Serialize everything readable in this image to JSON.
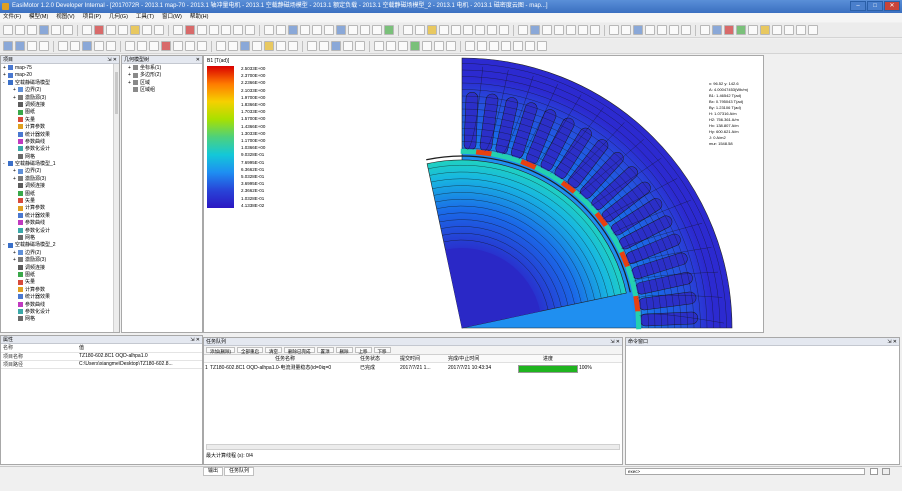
{
  "window": {
    "title": "EasiMotor 1.2.0 Developer Internal - [2017072R - 2013.1 map-70 - 2013.1 轴冲量电机 - 2013.1 空载静磁场模型 - 2013.1 额定负载 - 2013.1 空载静磁场模型_2 - 2013.1 电机 - 2013.1 磁密度云图 - map...]"
  },
  "menu": [
    "文件(F)",
    "模型(M)",
    "视图(V)",
    "项目(P)",
    "几何(G)",
    "工具(T)",
    "窗口(W)",
    "帮助(H)"
  ],
  "project_panel": {
    "title": "项目",
    "items": [
      {
        "label": "map-75",
        "depth": 0,
        "exp": "+",
        "icon": "#4a78d0"
      },
      {
        "label": "map-20",
        "depth": 0,
        "exp": "+",
        "icon": "#4a78d0"
      },
      {
        "label": "空载静磁场模型",
        "depth": 0,
        "exp": "-",
        "icon": "#3a6fc8"
      },
      {
        "label": "边界(2)",
        "depth": 1,
        "exp": "+",
        "icon": "#6090d8"
      },
      {
        "label": "激励源(3)",
        "depth": 1,
        "exp": "+",
        "icon": "#7a7a7a"
      },
      {
        "label": "调频连接",
        "depth": 1,
        "exp": "",
        "icon": "#5c5c5c"
      },
      {
        "label": "图纸",
        "depth": 1,
        "exp": "",
        "icon": "#3aa84a"
      },
      {
        "label": "矢量",
        "depth": 1,
        "exp": "",
        "icon": "#d84a3a"
      },
      {
        "label": "计算参数",
        "depth": 1,
        "exp": "",
        "icon": "#e0a020"
      },
      {
        "label": "统计器效果",
        "depth": 1,
        "exp": "",
        "icon": "#4a78d0"
      },
      {
        "label": "参数曲线",
        "depth": 1,
        "exp": "",
        "icon": "#c03ac0"
      },
      {
        "label": "参数化设计",
        "depth": 1,
        "exp": "",
        "icon": "#3aa8a8"
      },
      {
        "label": "网格",
        "depth": 1,
        "exp": "",
        "icon": "#6a6a6a"
      },
      {
        "label": "空载静磁场模型_1",
        "depth": 0,
        "exp": "-",
        "icon": "#3a6fc8"
      },
      {
        "label": "边界(2)",
        "depth": 1,
        "exp": "+",
        "icon": "#6090d8"
      },
      {
        "label": "激励源(3)",
        "depth": 1,
        "exp": "+",
        "icon": "#7a7a7a"
      },
      {
        "label": "调频连接",
        "depth": 1,
        "exp": "",
        "icon": "#5c5c5c"
      },
      {
        "label": "图纸",
        "depth": 1,
        "exp": "",
        "icon": "#3aa84a"
      },
      {
        "label": "矢量",
        "depth": 1,
        "exp": "",
        "icon": "#d84a3a"
      },
      {
        "label": "计算参数",
        "depth": 1,
        "exp": "",
        "icon": "#e0a020"
      },
      {
        "label": "统计器效果",
        "depth": 1,
        "exp": "",
        "icon": "#4a78d0"
      },
      {
        "label": "参数曲线",
        "depth": 1,
        "exp": "",
        "icon": "#c03ac0"
      },
      {
        "label": "参数化设计",
        "depth": 1,
        "exp": "",
        "icon": "#3aa8a8"
      },
      {
        "label": "网格",
        "depth": 1,
        "exp": "",
        "icon": "#6a6a6a"
      },
      {
        "label": "空载静磁场模型_2",
        "depth": 0,
        "exp": "-",
        "icon": "#3a6fc8"
      },
      {
        "label": "边界(2)",
        "depth": 1,
        "exp": "+",
        "icon": "#6090d8"
      },
      {
        "label": "激励源(3)",
        "depth": 1,
        "exp": "+",
        "icon": "#7a7a7a"
      },
      {
        "label": "调频连接",
        "depth": 1,
        "exp": "",
        "icon": "#5c5c5c"
      },
      {
        "label": "图纸",
        "depth": 1,
        "exp": "",
        "icon": "#3aa84a"
      },
      {
        "label": "矢量",
        "depth": 1,
        "exp": "",
        "icon": "#d84a3a"
      },
      {
        "label": "计算参数",
        "depth": 1,
        "exp": "",
        "icon": "#e0a020"
      },
      {
        "label": "统计器效果",
        "depth": 1,
        "exp": "",
        "icon": "#4a78d0"
      },
      {
        "label": "参数曲线",
        "depth": 1,
        "exp": "",
        "icon": "#c03ac0"
      },
      {
        "label": "参数化设计",
        "depth": 1,
        "exp": "",
        "icon": "#3aa8a8"
      },
      {
        "label": "网格",
        "depth": 1,
        "exp": "",
        "icon": "#6a6a6a"
      }
    ]
  },
  "geometry_panel": {
    "title": "几何模型树",
    "items": [
      {
        "label": "坐标系(1)",
        "depth": 1,
        "exp": "+"
      },
      {
        "label": "多边形(2)",
        "depth": 1,
        "exp": "+"
      },
      {
        "label": "区域",
        "depth": 1,
        "exp": "+"
      },
      {
        "label": "区域组",
        "depth": 1,
        "exp": ""
      }
    ]
  },
  "properties_panel": {
    "title": "属性",
    "header": [
      "名称",
      "值"
    ],
    "rows": [
      {
        "k": "项目名称",
        "v": "TZ180-602.8C1 OQD-alhpa1.0"
      },
      {
        "k": "项目路径",
        "v": "C:\\Users\\xiangme\\Desktop\\TZ180-602.8..."
      }
    ]
  },
  "plot": {
    "legend_title": "B1 [T(ad)]",
    "legend_labels": [
      "2.5033E+00",
      "2.3700E+00",
      "2.2366E+00",
      "2.1033E+00",
      "1.9700E+00",
      "1.8366E+00",
      "1.7033E+00",
      "1.5700E+00",
      "1.4366E+00",
      "1.3033E+00",
      "1.1700E+00",
      "1.0366E+00",
      "9.0328E-01",
      "7.6995E-01",
      "6.3662E-01",
      "5.0328E-01",
      "3.6995E-01",
      "2.3662E-01",
      "1.0328E-01",
      "4.1338E-02"
    ],
    "readout": [
      "x: 96.52  y: 142.6",
      "A: 4.00047453(Wb/m)",
      "B1: 1.46542 T(ad)",
      "Bx: 0.795043 T(ad)",
      "By: 1.23106 T(ad)",
      "H: 1.07316 A/m",
      "H2: 756.361 A/m",
      "Hx: 138.807 A/m",
      "Hy: 600.621 A/m",
      "J: 0 A/m2",
      "mur: 1548.58"
    ]
  },
  "tasks_panel": {
    "title": "任务队列",
    "buttons": [
      "添加(删除)",
      "全部重启",
      "清空",
      "删除已完成",
      "置顶",
      "删除",
      "上移",
      "下移"
    ],
    "columns": [
      "",
      "任务名称",
      "任务状态",
      "提交时间",
      "完成/中止时间",
      "进度"
    ],
    "rows": [
      {
        "id": "1",
        "name": "TZ180-602.8C1 OQD-alhpa1.0-电流测量稳态(id=0iq=0",
        "status": "已完成",
        "submitted": "2017/7/21 1...",
        "finished": "2017/7/21 10:43:34",
        "progress": 1.0,
        "progress_label": "100%"
      }
    ],
    "max_threads_label": "最大计算线程 (s):",
    "max_threads_value": "0/4"
  },
  "command_panel": {
    "title": "命令窗口",
    "input_value": "exec>"
  },
  "bottom_tabs": [
    "输出",
    "任务队列"
  ],
  "colors": {
    "accent": "#3a6fc0",
    "progress": "#1fb41f"
  }
}
